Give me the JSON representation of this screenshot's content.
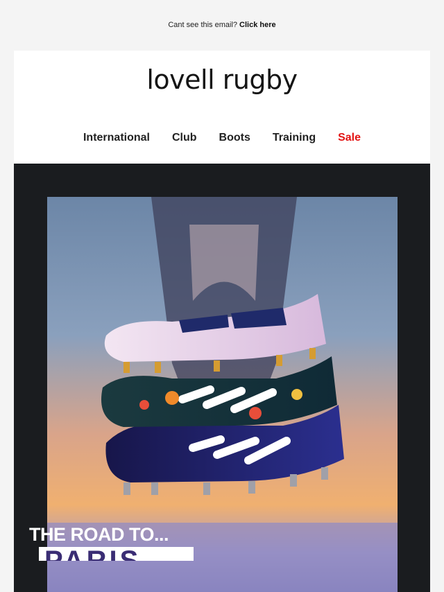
{
  "preheader": {
    "text": "Cant see this email?",
    "cta": "Click here"
  },
  "brand": {
    "logo": "lovell rugby"
  },
  "nav": [
    {
      "label": "International"
    },
    {
      "label": "Club"
    },
    {
      "label": "Boots"
    },
    {
      "label": "Training"
    },
    {
      "label": "Sale",
      "color": "#e31414"
    }
  ],
  "hero": {
    "headline": "THE ROAD TO...",
    "headline_big": "PARIS"
  },
  "colors": {
    "accent_sale": "#e31414",
    "hero_frame": "#1a1c1f"
  }
}
